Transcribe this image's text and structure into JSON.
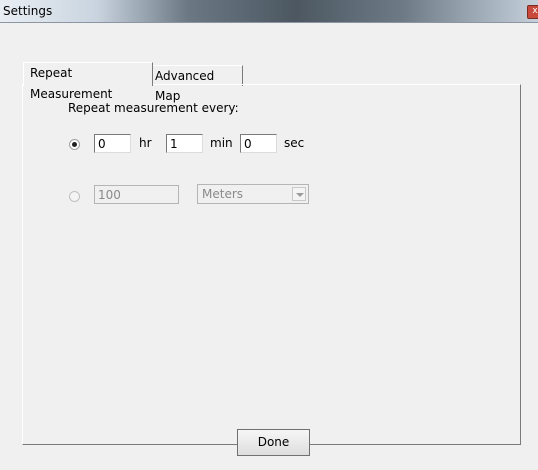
{
  "window": {
    "title": "Settings",
    "close_glyph": "x"
  },
  "tabs": [
    {
      "label": "Repeat Measurement",
      "active": true
    },
    {
      "label": "Advanced Map",
      "active": false
    }
  ],
  "repeat": {
    "heading": "Repeat measurement every:",
    "hr_value": "0",
    "hr_unit": "hr",
    "min_value": "1",
    "min_unit": "min",
    "sec_value": "0",
    "sec_unit": "sec",
    "time_option_selected": true
  },
  "distance": {
    "value": "100",
    "unit_selected": "Meters",
    "enabled": false
  },
  "buttons": {
    "done": "Done"
  }
}
